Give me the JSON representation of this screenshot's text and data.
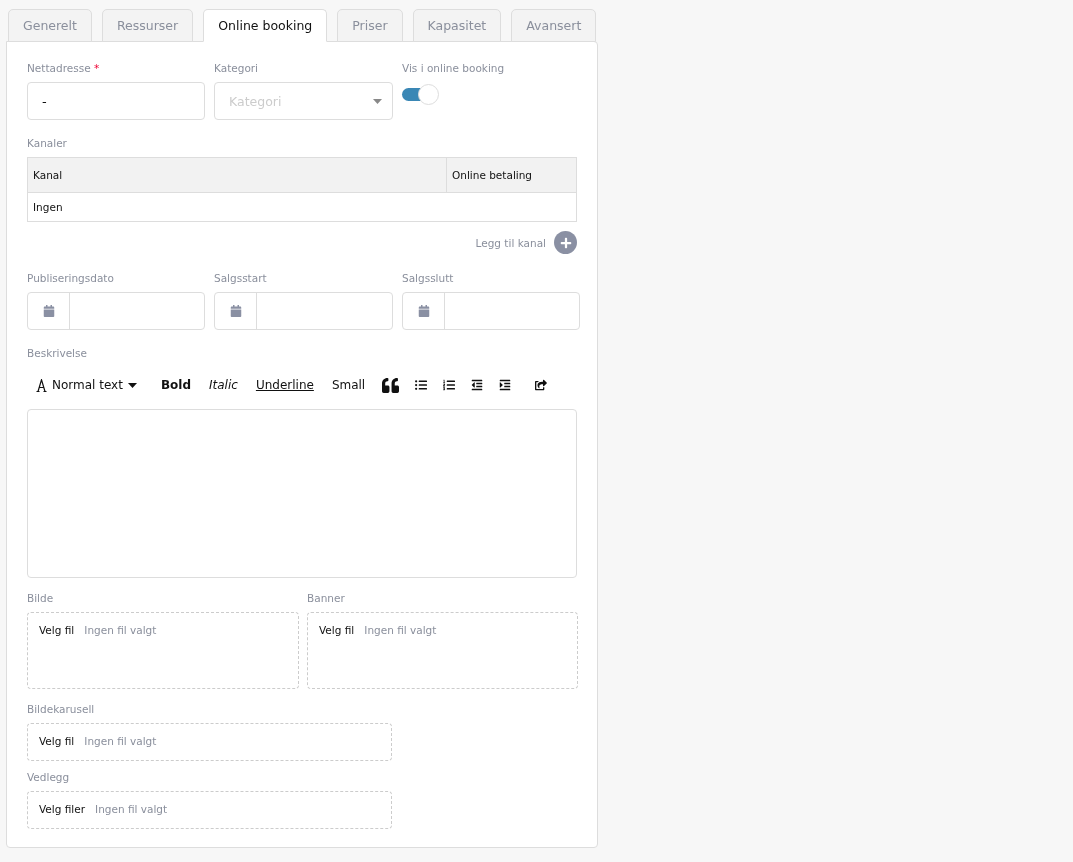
{
  "tabs": [
    {
      "label": "Generelt",
      "selected": false
    },
    {
      "label": "Ressurser",
      "selected": false
    },
    {
      "label": "Online booking",
      "selected": true
    },
    {
      "label": "Priser",
      "selected": false
    },
    {
      "label": "Kapasitet",
      "selected": false
    },
    {
      "label": "Avansert",
      "selected": false
    }
  ],
  "url_field": {
    "label": "Nettadresse",
    "required": true,
    "required_mark": "*",
    "value": "-"
  },
  "category_field": {
    "label": "Kategori",
    "placeholder": "Kategori"
  },
  "show_toggle": {
    "label": "Vis i online booking",
    "on": true
  },
  "channels": {
    "label": "Kanaler",
    "columns": [
      "Kanal",
      "Online betaling"
    ],
    "rows": [
      [
        "Ingen",
        ""
      ]
    ],
    "add_label": "Legg til kanal"
  },
  "dates": [
    {
      "label": "Publiseringsdato"
    },
    {
      "label": "Salgsstart"
    },
    {
      "label": "Salgsslutt"
    }
  ],
  "description": {
    "label": "Beskrivelse",
    "toolbar": [
      {
        "kind": "style",
        "label": "Normal text"
      },
      {
        "kind": "bold",
        "label": "Bold"
      },
      {
        "kind": "italic",
        "label": "Italic"
      },
      {
        "kind": "underline",
        "label": "Underline"
      },
      {
        "kind": "small",
        "label": "Small"
      }
    ]
  },
  "uploads_row": [
    {
      "label": "Bilde",
      "button": "Velg fil",
      "status": "Ingen fil valgt"
    },
    {
      "label": "Banner",
      "button": "Velg fil",
      "status": "Ingen fil valgt"
    }
  ],
  "uploads": [
    {
      "label": "Bildekarusell",
      "button": "Velg fil",
      "status": "Ingen fil valgt"
    },
    {
      "label": "Vedlegg",
      "button": "Velg filer",
      "status": "Ingen fil valgt"
    }
  ]
}
